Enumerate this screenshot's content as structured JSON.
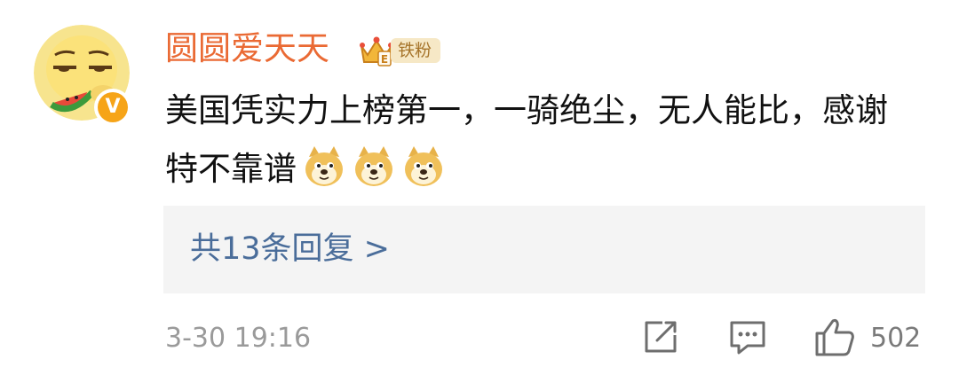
{
  "comment": {
    "username": "圆圆爱天天",
    "fan_badge": {
      "label": "铁粉",
      "icon": "crown-icon",
      "level": "E"
    },
    "verified_icon": "verified-v-icon",
    "text": "美国凭实力上榜第一，一骑绝尘，无人能比，感谢特不靠谱",
    "emojis": [
      "doge-emoji",
      "doge-emoji",
      "doge-emoji"
    ],
    "replies": {
      "label": "共13条回复 >"
    },
    "timestamp": "3-30 19:16",
    "actions": {
      "share_icon": "share-icon",
      "comment_icon": "comment-icon",
      "like_icon": "thumbs-up-icon",
      "like_count": "502"
    }
  },
  "colors": {
    "username": "#ea6a34",
    "reply_link": "#4a6d9a",
    "reply_box_bg": "#f4f4f4",
    "verified_badge": "#f6a418",
    "meta_text": "#9a9a9a"
  }
}
